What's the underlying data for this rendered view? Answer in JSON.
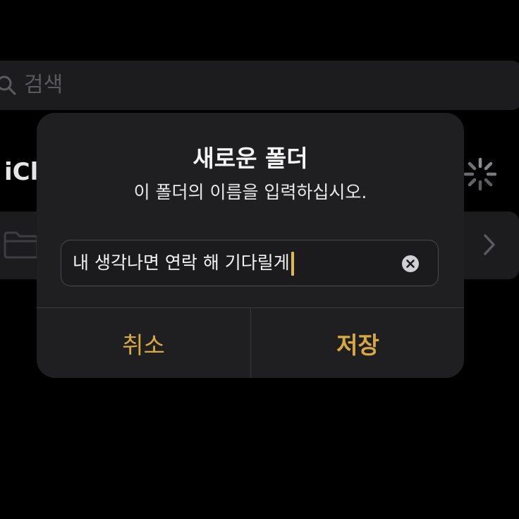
{
  "colors": {
    "background": "#000000",
    "surface": "#1c1c1e",
    "alert_background": "#1f1f21",
    "accent": "#d9a93f",
    "caret": "#e3b74a"
  },
  "background_app": {
    "search": {
      "icon": "search-icon",
      "placeholder": "검색"
    },
    "section_title": "iCl",
    "status_icon": "spinner-icon",
    "folder_row": {
      "icon": "folder-icon",
      "disclosure_icon": "chevron-right-icon"
    }
  },
  "alert": {
    "title": "새로운 폴더",
    "message": "이 폴더의 이름을 입력하십시오.",
    "input": {
      "value": "내 생각나면 연락 해 기다릴게",
      "clear_icon": "clear-icon"
    },
    "buttons": {
      "cancel_label": "취소",
      "save_label": "저장"
    }
  }
}
